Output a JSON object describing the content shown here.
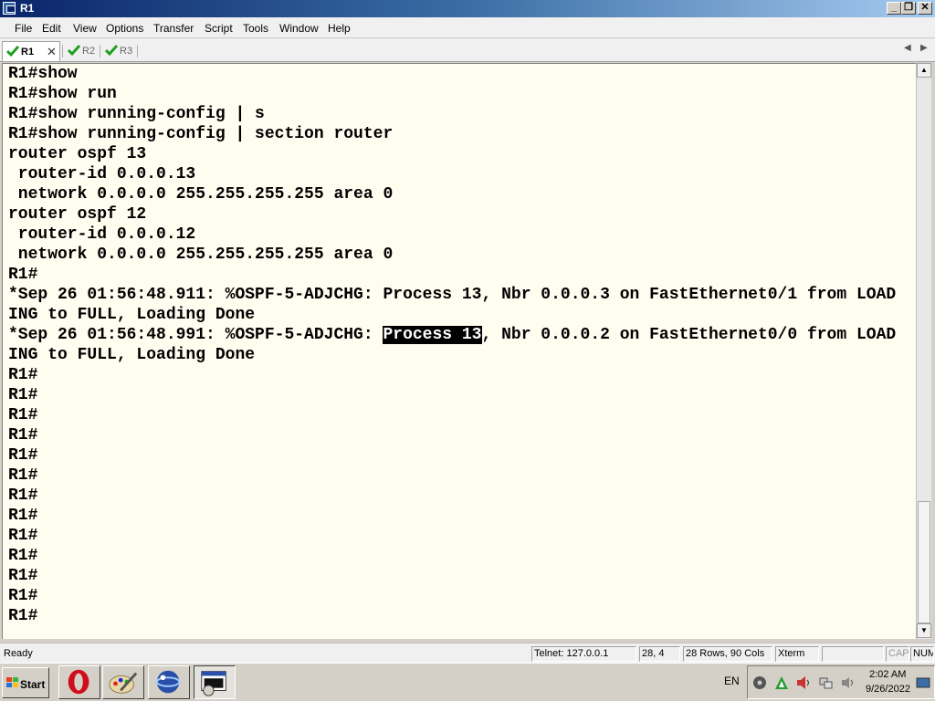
{
  "window": {
    "title": "R1"
  },
  "menu": [
    "File",
    "Edit",
    "View",
    "Options",
    "Transfer",
    "Script",
    "Tools",
    "Window",
    "Help"
  ],
  "tabs": [
    {
      "label": "R1",
      "active": true,
      "connected": true
    },
    {
      "label": "R2",
      "active": false,
      "connected": true
    },
    {
      "label": "R3",
      "active": false,
      "connected": true
    }
  ],
  "terminal": {
    "lines": [
      "R1#show",
      "R1#show run",
      "R1#show running-config | s",
      "R1#show running-config | section router",
      "router ospf 13",
      " router-id 0.0.0.13",
      " network 0.0.0.0 255.255.255.255 area 0",
      "router ospf 12",
      " router-id 0.0.0.12",
      " network 0.0.0.0 255.255.255.255 area 0",
      "R1#",
      "*Sep 26 01:56:48.911: %OSPF-5-ADJCHG: Process 13, Nbr 0.0.0.3 on FastEthernet0/1 from LOAD",
      "ING to FULL, Loading Done",
      "*Sep 26 01:56:48.991: %OSPF-5-ADJCHG: Process 13, Nbr 0.0.0.2 on FastEthernet0/0 from LOAD",
      "ING to FULL, Loading Done",
      "R1#",
      "R1#",
      "R1#",
      "R1#",
      "R1#",
      "R1#",
      "R1#",
      "R1#",
      "R1#",
      "R1#",
      "R1#",
      "R1#",
      "R1#"
    ],
    "selection": {
      "line_index": 13,
      "before": "*Sep 26 01:56:48.991: %OSPF-5-ADJCHG: ",
      "selected": "Process 13",
      "after": ", Nbr 0.0.0.2 on FastEthernet0/0 from LOAD"
    },
    "background": "#fffdf0"
  },
  "status": {
    "ready": "Ready",
    "connection": "Telnet: 127.0.0.1",
    "cursor": "28,  4",
    "size": "28 Rows, 90 Cols",
    "emulation": "Xterm",
    "caps": "CAP",
    "num": "NUM"
  },
  "taskbar": {
    "start": "Start",
    "lang": "EN",
    "time": "2:02 AM",
    "date": "9/26/2022",
    "apps": [
      "opera-icon",
      "paint-icon",
      "gns3-icon",
      "securecrt-icon"
    ]
  }
}
